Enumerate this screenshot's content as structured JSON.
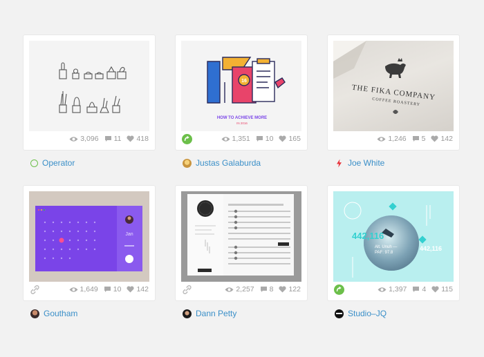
{
  "shots": [
    {
      "views": "3,096",
      "comments": "11",
      "likes": "418",
      "author": "Operator"
    },
    {
      "views": "1,351",
      "comments": "10",
      "likes": "165",
      "author": "Justas Galaburda",
      "caption": "HOW TO ACHIEVE MORE",
      "caption_year": "IN 2016",
      "badge_number": "16"
    },
    {
      "views": "1,246",
      "comments": "5",
      "likes": "142",
      "author": "Joe White",
      "logo_title": "THE FIKA COMPANY",
      "logo_sub": "COFFEE ROASTERY"
    },
    {
      "views": "1,649",
      "comments": "10",
      "likes": "142",
      "author": "Goutham",
      "month": "Jan"
    },
    {
      "views": "2,257",
      "comments": "8",
      "likes": "122",
      "author": "Dann Petty"
    },
    {
      "views": "1,397",
      "comments": "4",
      "likes": "115",
      "author": "Studio–JQ",
      "big_number": "442,116",
      "stat_label": "Alt. Unuh —",
      "stat_sub": "PAF: 97.8"
    }
  ],
  "colors": {
    "link": "#3a8fc8",
    "rebound": "#6cbf4a",
    "purple": "#7a44e8",
    "mint": "#b9efef"
  }
}
